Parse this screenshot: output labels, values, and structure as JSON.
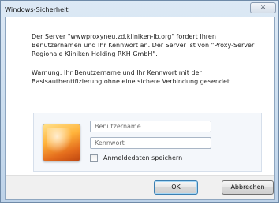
{
  "window": {
    "title": "Windows-Sicherheit",
    "close_glyph": "✕"
  },
  "message": {
    "server": "Der Server \"wwwproxyneu.zd.kliniken-lb.org\" fordert Ihren Benutzernamen und Ihr Kennwort an. Der Server ist von \"Proxy-Server Regionale Kliniken Holding RKH GmbH\".",
    "warning": "Warnung: Ihr Benutzername und Ihr Kennwort mit der Basisauthentifizierung ohne eine sichere Verbindung gesendet."
  },
  "credentials": {
    "username_placeholder": "Benutzername",
    "password_placeholder": "Kennwort",
    "remember_label": "Anmeldedaten speichern",
    "avatar_icon": "user-tile-icon"
  },
  "buttons": {
    "ok": "OK",
    "cancel": "Abbrechen"
  }
}
